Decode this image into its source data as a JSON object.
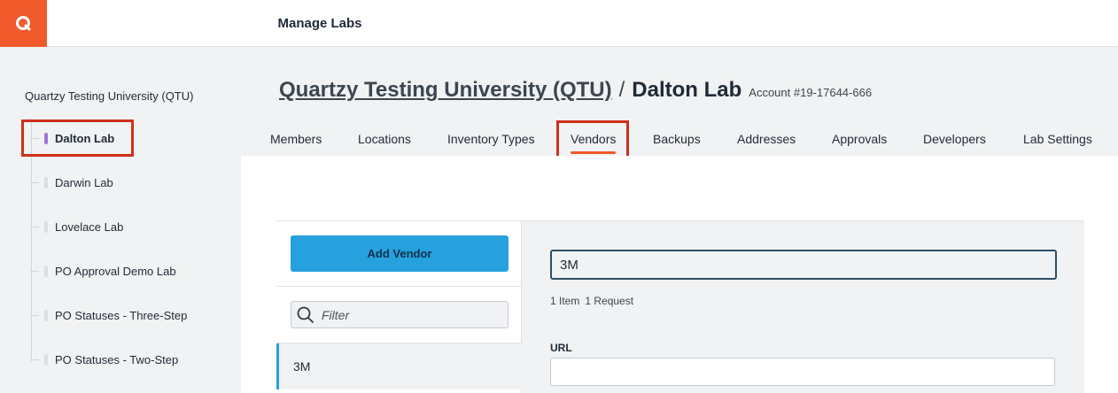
{
  "topbar": {
    "logo_letter": "Q",
    "title": "Manage Labs"
  },
  "sidebar": {
    "org_name": "Quartzy Testing University (QTU)",
    "labs": [
      {
        "label": "Dalton Lab",
        "active": true
      },
      {
        "label": "Darwin Lab",
        "active": false
      },
      {
        "label": "Lovelace Lab",
        "active": false
      },
      {
        "label": "PO Approval Demo Lab",
        "active": false
      },
      {
        "label": "PO Statuses - Three-Step",
        "active": false
      },
      {
        "label": "PO Statuses - Two-Step",
        "active": false
      }
    ]
  },
  "breadcrumb": {
    "org": "Quartzy Testing University (QTU)",
    "separator": "/",
    "lab": "Dalton Lab",
    "account": "Account #19-17644-666"
  },
  "tabs": [
    {
      "label": "Members"
    },
    {
      "label": "Locations"
    },
    {
      "label": "Inventory Types"
    },
    {
      "label": "Vendors",
      "active": true
    },
    {
      "label": "Backups"
    },
    {
      "label": "Addresses"
    },
    {
      "label": "Approvals"
    },
    {
      "label": "Developers"
    },
    {
      "label": "Lab Settings"
    }
  ],
  "vendors": {
    "add_button": "Add Vendor",
    "filter_placeholder": "Filter",
    "items": [
      "3M"
    ]
  },
  "vendor_detail": {
    "name_value": "3M",
    "item_count": "1 Item",
    "request_count": "1 Request",
    "url_label": "URL",
    "url_value": ""
  },
  "colors": {
    "brand": "#f15a2b",
    "primary_button": "#27a0de",
    "active_lab_marker": "#a173d8",
    "highlight_annotation": "#d0301a"
  }
}
